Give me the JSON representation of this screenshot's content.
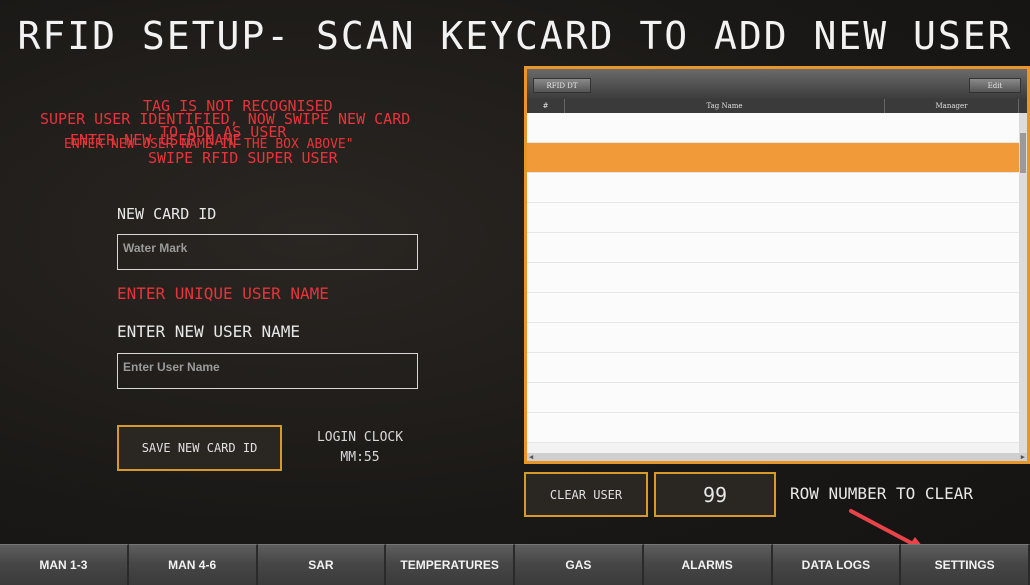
{
  "header": {
    "title": "RFID SETUP- SCAN KEYCARD TO ADD NEW USER"
  },
  "messages": [
    "TAG IS NOT RECOGNISED",
    "SUPER USER IDENTIFIED, NOW SWIPE NEW CARD",
    "TO ADD AS USER",
    "ENTER NEW USER NAME",
    "ENTER NEW USER NAME IN THE BOX ABOVE\"",
    "SWIPE RFID SUPER USER"
  ],
  "form": {
    "new_card_label": "NEW CARD ID",
    "card_id_value": "Water Mark",
    "error_text": "ENTER UNIQUE USER NAME",
    "user_name_label": "ENTER NEW USER NAME",
    "user_name_placeholder": "Enter User Name",
    "save_button": "SAVE NEW CARD ID"
  },
  "login_clock": {
    "label": "LOGIN CLOCK",
    "value": "MM:55"
  },
  "grid": {
    "tab_label": "RFID DT",
    "edit_label": "Edit",
    "columns": [
      "#",
      "Tag Name",
      "Manager"
    ],
    "selected_row_index": 1,
    "row_count": 11
  },
  "controls": {
    "clear_user_button": "CLEAR USER",
    "row_number_value": "99",
    "row_number_label": "ROW NUMBER TO CLEAR"
  },
  "nav": {
    "items": [
      "MAN 1-3",
      "MAN 4-6",
      "SAR",
      "TEMPERATURES",
      "GAS",
      "ALARMS",
      "DATA LOGS",
      "SETTINGS"
    ]
  },
  "colors": {
    "accent_orange": "#e8962a",
    "error_red": "#e8333a",
    "selected_row": "#f09a3a",
    "annotation_arrow": "#e8444a"
  },
  "icons": {
    "annotation": "arrow-icon"
  }
}
